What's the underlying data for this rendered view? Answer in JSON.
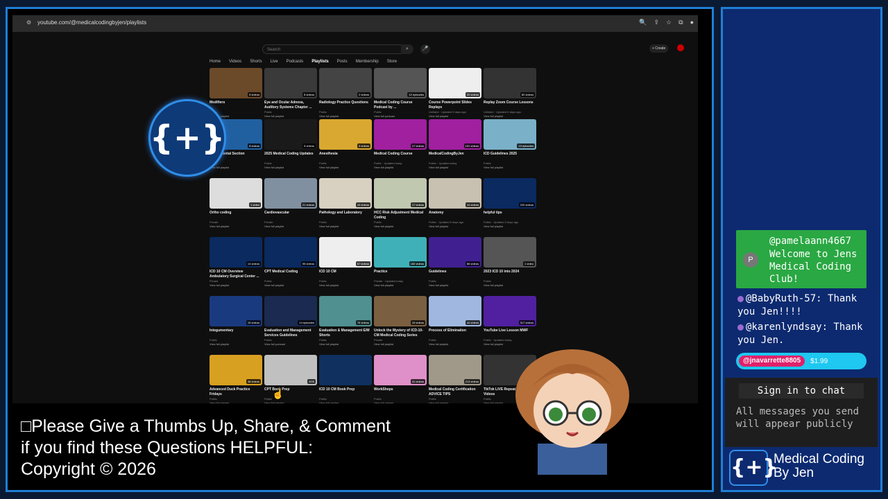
{
  "browser": {
    "url": "youtube.com/@medicalcodingbyjen/playlists"
  },
  "youtube": {
    "search_placeholder": "Search",
    "create_label": "+ Create",
    "tabs": [
      "Home",
      "Videos",
      "Shorts",
      "Live",
      "Podcasts",
      "Playlists",
      "Posts",
      "Membership",
      "Store"
    ],
    "active_tab": "Playlists"
  },
  "playlists": [
    [
      {
        "title": "Modifiers",
        "meta": "Public",
        "link": "View full playlist",
        "badge": "5 videos",
        "color": "#6b4a2a"
      },
      {
        "title": "Eye and Ocular Adnexa, Auditory Systems Chapter ...",
        "meta": "Public",
        "link": "View full playlist",
        "badge": "8 videos",
        "color": "#3a3a3a"
      },
      {
        "title": "Radiology Practice Questions",
        "meta": "Public",
        "link": "View full playlist",
        "badge": "2 videos",
        "color": "#444"
      },
      {
        "title": "Medical Coding Course Podcast by ...",
        "meta": "Public",
        "link": "View full podcast",
        "badge": "12 episodes",
        "color": "#555"
      },
      {
        "title": "Course Powerpoint Slides Replays",
        "meta": "Unlisted · Updated 5 days ago",
        "link": "View full playlist",
        "badge": "20 videos",
        "color": "#eee"
      },
      {
        "title": "Replay Zoom Course Lessons",
        "meta": "Unlisted · Updated 6 days ago",
        "link": "View full playlist",
        "badge": "82 videos",
        "color": "#333"
      }
    ],
    [
      {
        "title": "Integumental Section",
        "meta": "Public",
        "link": "View full playlist",
        "badge": "8 videos",
        "color": "#2060a0"
      },
      {
        "title": "2025 Medical Coding Updates",
        "meta": "Public",
        "link": "View full playlist",
        "badge": "5 videos",
        "color": "#1a1a1a"
      },
      {
        "title": "Anesthesia",
        "meta": "Public",
        "link": "View full playlist",
        "badge": "5 videos",
        "color": "#d8a830"
      },
      {
        "title": "Medical Coding Course",
        "meta": "Public · Updated today",
        "link": "View full playlist",
        "badge": "17 videos",
        "color": "#a020a0"
      },
      {
        "title": "MedicalCodingByJen",
        "meta": "Public · Updated today",
        "link": "View full playlist",
        "badge": "151 videos",
        "color": "#a020a0"
      },
      {
        "title": "ICD Guidelines 2025",
        "meta": "Public",
        "link": "View full playlist",
        "badge": "19 episodes",
        "color": "#7ab0c8"
      }
    ],
    [
      {
        "title": "Ortho coding",
        "meta": "Private",
        "link": "View full playlist",
        "badge": "1 video",
        "color": "#ddd"
      },
      {
        "title": "Cardiovascular",
        "meta": "Private",
        "link": "View full playlist",
        "badge": "21 videos",
        "color": "#8090a0"
      },
      {
        "title": "Pathology and Laboratory",
        "meta": "Public",
        "link": "View full playlist",
        "badge": "15 videos",
        "color": "#d8d0c0"
      },
      {
        "title": "HCC Risk Adjustment Medical Coding",
        "meta": "Public",
        "link": "View full playlist",
        "badge": "17 videos",
        "color": "#c0c8b0"
      },
      {
        "title": "Anatomy",
        "meta": "Public · Updated 5 days ago",
        "link": "View full playlist",
        "badge": "14 videos",
        "color": "#c8c0b0"
      },
      {
        "title": "helpful tips",
        "meta": "Public · Updated 3 days ago",
        "link": "View full playlist",
        "badge": "220 videos",
        "color": "#0a2a60"
      }
    ],
    [
      {
        "title": "ICD 10 CM Overview Ambulatory Surgical Center ...",
        "meta": "Private",
        "link": "View full playlist",
        "badge": "14 videos",
        "color": "#0a2a60"
      },
      {
        "title": "CPT Medical Coding",
        "meta": "Public",
        "link": "View full playlist",
        "badge": "95 videos",
        "color": "#0a2a60"
      },
      {
        "title": "ICD 10 CM",
        "meta": "Public",
        "link": "View full playlist",
        "badge": "67 videos",
        "color": "#eee"
      },
      {
        "title": "Practice",
        "meta": "Private · Updated today",
        "link": "View full playlist",
        "badge": "182 videos",
        "color": "#40b0b8"
      },
      {
        "title": "Guidelines",
        "meta": "Public",
        "link": "View full playlist",
        "badge": "86 videos",
        "color": "#402090"
      },
      {
        "title": "2023 ICD 10 into 2024",
        "meta": "Public",
        "link": "View full playlist",
        "badge": "1 video",
        "color": "#555"
      }
    ],
    [
      {
        "title": "Integumentary",
        "meta": "Public",
        "link": "View full playlist",
        "badge": "15 videos",
        "color": "#1a3a80"
      },
      {
        "title": "Evaluation and Management Services Guidelines",
        "meta": "Public",
        "link": "View full podcast",
        "badge": "14 episodes",
        "color": "#1a2a50"
      },
      {
        "title": "Evaluation & Management E/M Shorts",
        "meta": "Public",
        "link": "View full playlist",
        "badge": "76 videos",
        "color": "#509090"
      },
      {
        "title": "Unlock the Mystery of ICD-10-CM Medical Coding Series",
        "meta": "Private",
        "link": "View full playlist",
        "badge": "19 videos",
        "color": "#7a6040"
      },
      {
        "title": "Process of Elimination",
        "meta": "Public",
        "link": "View full playlist",
        "badge": "44 videos",
        "color": "#a0b8e0"
      },
      {
        "title": "YouTube Live Lesson MWF",
        "meta": "Public · Updated today",
        "link": "View full playlist",
        "badge": "317 videos",
        "color": "#5020a0"
      }
    ],
    [
      {
        "title": "Advanced Duck Practice Fridays",
        "meta": "Public",
        "link": "View full playlist",
        "badge": "38 videos",
        "color": "#d8a020"
      },
      {
        "title": "CPT Book Prep",
        "meta": "Public",
        "link": "View full playlist",
        "badge": "9/26",
        "color": "#c0c0c0"
      },
      {
        "title": "ICD 10 CM Book Prep",
        "meta": "Public",
        "link": "View full playlist",
        "badge": "",
        "color": "#103060"
      },
      {
        "title": "WorkShops",
        "meta": "Public",
        "link": "View full playlist",
        "badge": "41 videos",
        "color": "#e090c8"
      },
      {
        "title": "Medical Coding Certification ADVICE TIPS",
        "meta": "Public",
        "link": "View full playlist",
        "badge": "213 videos",
        "color": "#a09888"
      },
      {
        "title": "TikTok LIVE Repeat MWF Videos",
        "meta": "Public",
        "link": "View full playlist",
        "badge": "26",
        "color": "#333"
      }
    ]
  ],
  "caption": {
    "line1": "□Please Give a Thumbs Up, Share, & Comment",
    "line2": "if you find these Questions HELPFUL:",
    "line3": " Copyright © 2026"
  },
  "chat": {
    "first": {
      "initial": "P",
      "user": "@pamelaann4667",
      "message": "Welcome to Jens Medical Coding Club!"
    },
    "line2_user": "@BabyRuth-57",
    "line2_msg": ": Thank you Jen!!!!",
    "line3_user": "@karenlyndsay",
    "line3_msg": ": Thank you Jen.",
    "superchat_user": "@jnavarrette8805",
    "superchat_amount": "$1.99",
    "signin": "Sign in to chat",
    "signin_note": "All messages you send will appear publicly"
  },
  "brand": {
    "line1": "Medical Coding",
    "line2": "By Jen"
  },
  "colors": {
    "frame": "#1f7fd6",
    "panel": "#0d2a70",
    "chat_highlight": "#2aa843",
    "superchat": "#1ec8f0"
  }
}
